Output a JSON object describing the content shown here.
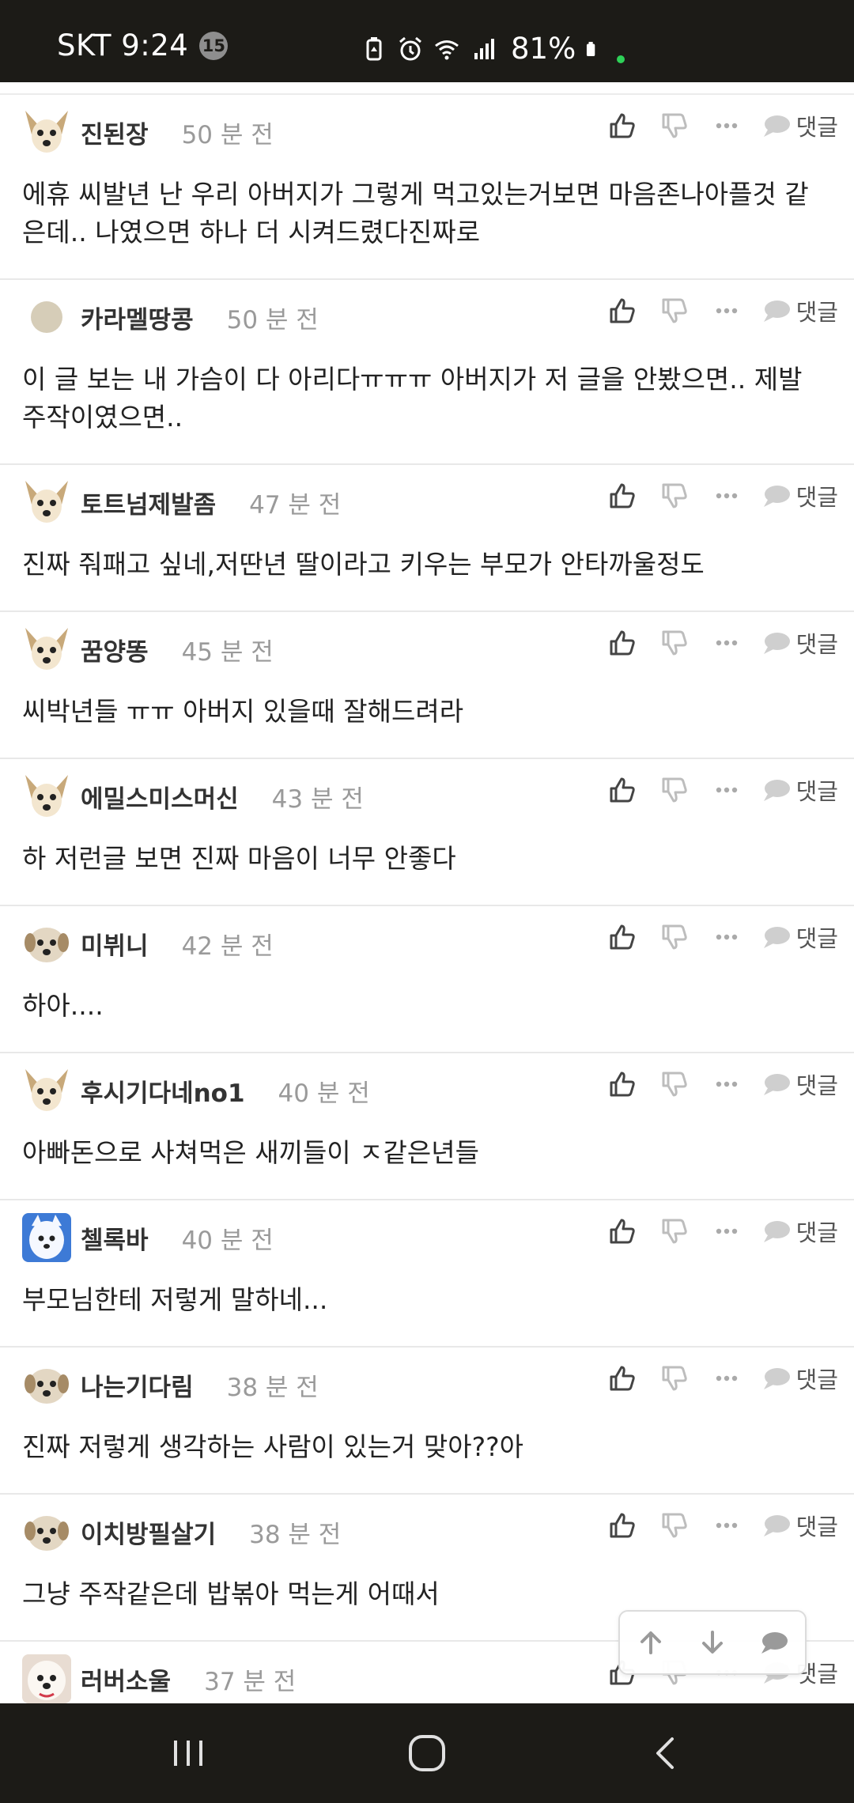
{
  "status_bar": {
    "carrier_time": "SKT 9:24",
    "notification_count": "15",
    "battery": "81%"
  },
  "comments": [
    {
      "nick": "진된장",
      "time": "50 분 전",
      "body": "에휴 씨발년 난 우리 아버지가 그렇게 먹고있는거보면 마음존나아플것 같은데.. 나였으면 하나 더 시켜드렸다진짜로",
      "avatar": "chihuahua"
    },
    {
      "nick": "카라멜땅콩",
      "time": "50 분 전",
      "body": "이 글 보는 내 가슴이 다 아리다ㅠㅠㅠ 아버지가 저 글을 안봤으면.. 제발 주작이였으면..",
      "avatar": "circle"
    },
    {
      "nick": "토트넘제발좀",
      "time": "47 분 전",
      "body": "진짜 줘패고 싶네,저딴년 딸이라고 키우는 부모가 안타까울정도",
      "avatar": "chihuahua"
    },
    {
      "nick": "꿈양똥",
      "time": "45 분 전",
      "body": "씨박년들 ㅠㅠ 아버지 있을때 잘해드려라",
      "avatar": "chihuahua"
    },
    {
      "nick": "에밀스미스머신",
      "time": "43 분 전",
      "body": "하 저런글 보면 진짜 마음이 너무 안좋다",
      "avatar": "chihuahua"
    },
    {
      "nick": "미뷔니",
      "time": "42 분 전",
      "body": "하아....",
      "avatar": "puppy"
    },
    {
      "nick": "후시기다네no1",
      "time": "40 분 전",
      "body": "아빠돈으로 사쳐먹은 새끼들이 ㅈ같은년들",
      "avatar": "chihuahua"
    },
    {
      "nick": "첼록바",
      "time": "40 분 전",
      "body": "부모님한테 저렇게 말하네...",
      "avatar": "spitz"
    },
    {
      "nick": "나는기다림",
      "time": "38 분 전",
      "body": "진짜 저렇게 생각하는 사람이 있는거 맞아??아",
      "avatar": "puppy"
    },
    {
      "nick": "이치방필살기",
      "time": "38 분 전",
      "body": "그냥 주작같은데 밥볶아 먹는게 어때서",
      "avatar": "puppy"
    },
    {
      "nick": "러버소울",
      "time": "37 분 전",
      "body": "",
      "avatar": "maltese"
    }
  ],
  "labels": {
    "reply": "댓글"
  },
  "icons": {
    "like": "thumbs-up-icon",
    "dislike": "thumbs-down-icon",
    "more": "more-dots-icon",
    "reply": "speech-bubble-icon"
  },
  "colors": {
    "status_bar_bg": "#1c1b17",
    "nick": "#333333",
    "time": "#9a9a9a"
  }
}
